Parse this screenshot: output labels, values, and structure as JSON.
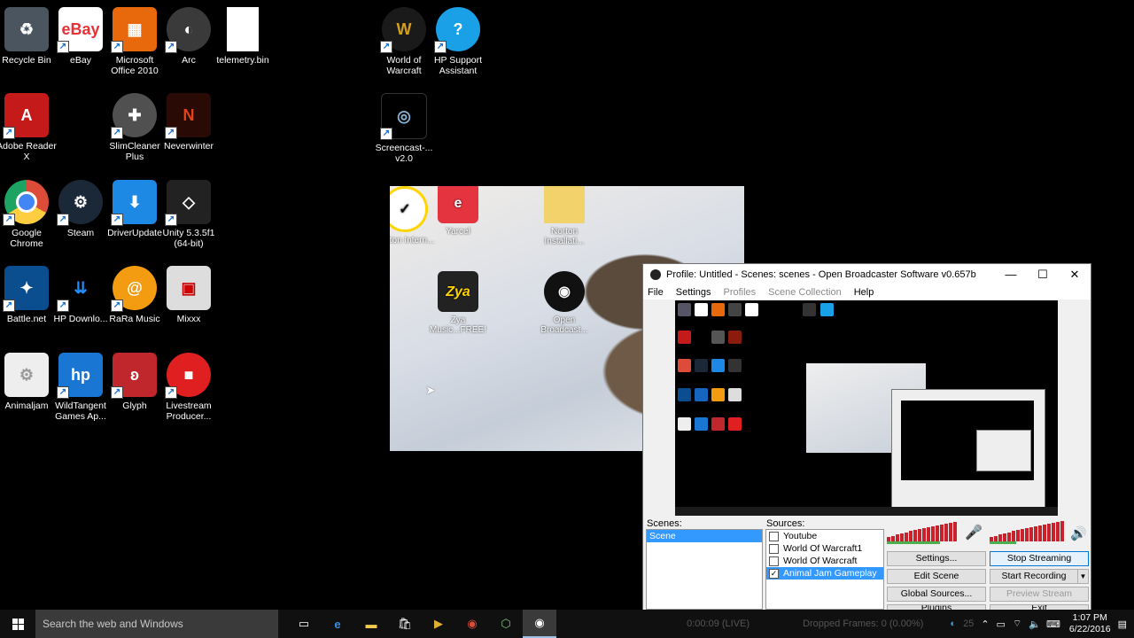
{
  "desktop_icons": [
    {
      "label": "Recycle Bin",
      "icon": "recycle-bin-icon",
      "color": "#4a5560"
    },
    {
      "label": "eBay",
      "icon": "ebay-icon",
      "color": "#ffffff"
    },
    {
      "label": "Microsoft Office 2010",
      "icon": "office-icon",
      "color": "#e8690b"
    },
    {
      "label": "Arc",
      "icon": "arc-icon",
      "color": "#3a3a3a"
    },
    {
      "label": "telemetry.bin",
      "icon": "file-icon",
      "color": "#ffffff"
    },
    {
      "label": "Adobe Reader X",
      "icon": "adobe-reader-icon",
      "color": "#c51a1a"
    },
    {
      "label": "SlimCleaner Plus",
      "icon": "slimcleaner-icon",
      "color": "#505050"
    },
    {
      "label": "Neverwinter",
      "icon": "neverwinter-icon",
      "color": "#8a1b0d"
    },
    {
      "label": "Google Chrome",
      "icon": "chrome-icon",
      "color": "#dd4b39"
    },
    {
      "label": "Steam",
      "icon": "steam-icon",
      "color": "#1b2838"
    },
    {
      "label": "DriverUpdate",
      "icon": "driverupdate-icon",
      "color": "#1e88e5"
    },
    {
      "label": "Unity 5.3.5f1 (64-bit)",
      "icon": "unity-icon",
      "color": "#222222"
    },
    {
      "label": "Battle.net",
      "icon": "battlenet-icon",
      "color": "#0b4e8f"
    },
    {
      "label": "HP Downlo...",
      "icon": "hp-download-icon",
      "color": "#1565c0"
    },
    {
      "label": "RaRa Music",
      "icon": "rara-music-icon",
      "color": "#f39c12"
    },
    {
      "label": "Mixxx",
      "icon": "mixxx-icon",
      "color": "#dddddd"
    },
    {
      "label": "Animaljam",
      "icon": "animaljam-icon",
      "color": "#eeeeee"
    },
    {
      "label": "WildTangent Games Ap...",
      "icon": "wildtangent-icon",
      "color": "#1976d2"
    },
    {
      "label": "Glyph",
      "icon": "glyph-icon",
      "color": "#c0272d"
    },
    {
      "label": "Livestream Producer...",
      "icon": "livestream-icon",
      "color": "#e02020"
    },
    {
      "label": "World of Warcraft",
      "icon": "wow-icon",
      "color": "#1a1a1a"
    },
    {
      "label": "HP Support Assistant",
      "icon": "hp-support-icon",
      "color": "#1aa0e6"
    },
    {
      "label": "Screencast-... v2.0",
      "icon": "screencast-icon",
      "color": "#000000"
    }
  ],
  "wallpaper_icons": [
    {
      "label": "Norton Intern...",
      "icon": "norton-icon",
      "color": "#ffd400"
    },
    {
      "label": "Yarcel",
      "icon": "yarcel-icon",
      "color": "#e3343f"
    },
    {
      "label": "Norton Installati...",
      "icon": "folder-icon",
      "color": "#f2d26b"
    },
    {
      "label": "Zya Music...FREE!",
      "icon": "zya-icon",
      "color": "#222222"
    },
    {
      "label": "Open Broadcast...",
      "icon": "obs-icon",
      "color": "#111111"
    }
  ],
  "obs": {
    "title": "Profile: Untitled - Scenes: scenes - Open Broadcaster Software v0.657b",
    "menu": [
      "File",
      "Settings",
      "Profiles",
      "Scene Collection",
      "Help"
    ],
    "scenes_label": "Scenes:",
    "sources_label": "Sources:",
    "scenes": [
      "Scene"
    ],
    "sources": [
      {
        "label": "Youtube",
        "checked": false
      },
      {
        "label": "World Of Warcraft1",
        "checked": false
      },
      {
        "label": "World Of Warcraft",
        "checked": false
      },
      {
        "label": "Animal Jam Gameplay",
        "checked": true
      }
    ],
    "buttons": {
      "settings": "Settings...",
      "stop_streaming": "Stop Streaming",
      "edit_scene": "Edit Scene",
      "start_recording": "Start Recording",
      "global_sources": "Global Sources...",
      "preview_stream": "Preview Stream",
      "plugins": "Plugins",
      "exit": "Exit"
    },
    "status_time": "0:00:09 (LIVE)",
    "status_dropped": "Dropped Frames: 0 (0.00%)",
    "status_fps": "25"
  },
  "taskbar": {
    "search_placeholder": "Search the web and Windows",
    "time": "1:07 PM",
    "date": "6/22/2016",
    "apps": [
      "task-view-icon",
      "edge-icon",
      "file-explorer-icon",
      "store-icon",
      "media-icon",
      "chrome-icon",
      "hp-icon",
      "obs-icon"
    ]
  }
}
